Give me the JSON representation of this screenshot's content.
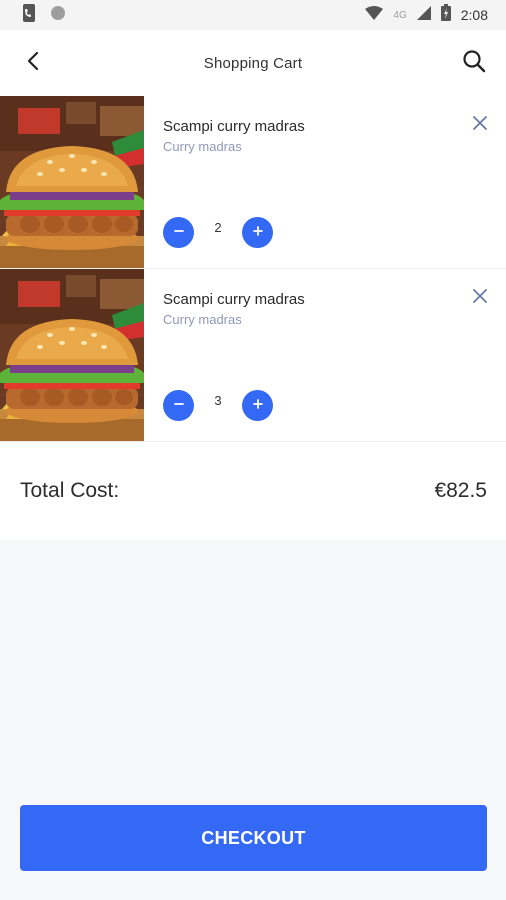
{
  "status_bar": {
    "time": "2:08",
    "network": "4G"
  },
  "header": {
    "title": "Shopping Cart"
  },
  "cart": {
    "items": [
      {
        "name": "Scampi curry madras",
        "subtitle": "Curry madras",
        "quantity": "2"
      },
      {
        "name": "Scampi curry madras",
        "subtitle": "Curry madras",
        "quantity": "3"
      }
    ]
  },
  "summary": {
    "total_label": "Total Cost:",
    "total_value": "€82.5"
  },
  "checkout": {
    "label": "CHECKOUT"
  },
  "colors": {
    "accent": "#3369f5",
    "subtitle": "#8f98b8",
    "background": "#f6f8fb"
  }
}
